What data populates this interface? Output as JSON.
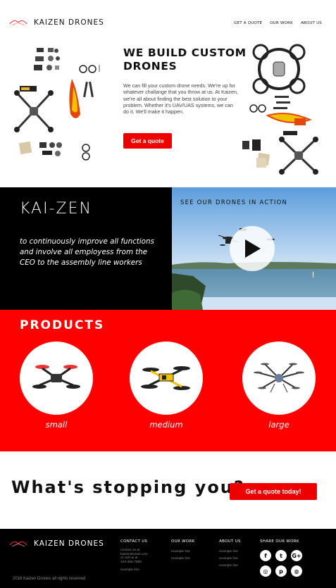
{
  "header": {
    "brand": "KAIZEN DRONES",
    "nav": [
      "GET A QUOTE",
      "OUR WORK",
      "ABOUT US"
    ]
  },
  "hero": {
    "title": "WE BUILD CUSTOM DRONES",
    "text": "We can fill your custom drone needs. We're up for whatever challange that you throw at us. At Kaizen, we're all about finding the best solution to your problem. Whether it's UAV/UAS systems, we can do it. We'll make it happen.",
    "button": "Get a quote"
  },
  "kaizen": {
    "title": "KAI-ZEN",
    "text": "to continuously  improve all functions and involve all employess from the CEO to the assembly line workers"
  },
  "video": {
    "label": "SEE OUR DRONES IN ACTION"
  },
  "products": {
    "title": "PRODUCTS",
    "items": [
      {
        "label": "small"
      },
      {
        "label": "medium"
      },
      {
        "label": "large"
      }
    ]
  },
  "cta": {
    "text": "What's stopping you?",
    "button": "Get a quote today!"
  },
  "footer": {
    "brand": "KAIZEN DRONES",
    "copyright": "2016 Kaizen Drones all rights reserved",
    "contact": {
      "heading": "CONTACT US",
      "lines": [
        "contact us at",
        "kaizendrones.com",
        "or call us at",
        "123-456-7890"
      ],
      "link": "example line"
    },
    "our_work": {
      "heading": "OUR WORK",
      "links": [
        "example line",
        "example line"
      ]
    },
    "about": {
      "heading": "ABOUT US",
      "links": [
        "example line",
        "example line",
        "example line"
      ]
    },
    "share": {
      "heading": "SHARE OUR WORK",
      "icons": [
        "facebook-icon",
        "twitter-icon",
        "google-plus-icon",
        "instagram-icon",
        "pinterest-icon",
        "dribbble-icon"
      ]
    }
  },
  "colors": {
    "accent": "#ff0000",
    "dark": "#000000"
  }
}
